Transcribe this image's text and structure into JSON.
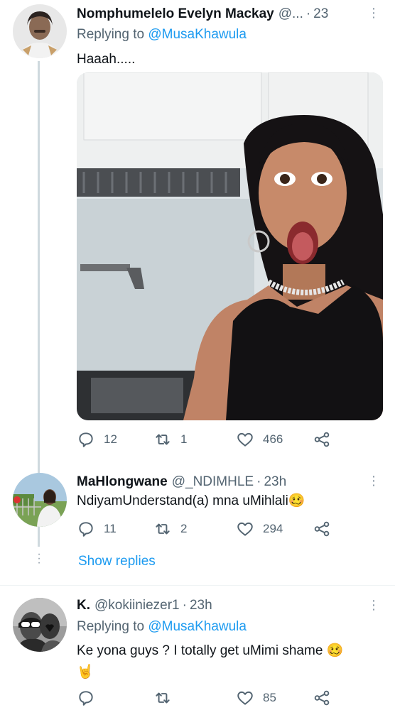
{
  "tweets": [
    {
      "name": "Nomphumelelo Evelyn Mackay",
      "handle": "@...",
      "time": "23h",
      "replying_label": "Replying to",
      "replying_to": "@MusaKhawula",
      "text": "Haaah.....",
      "replies": "12",
      "retweets": "1",
      "likes": "466"
    },
    {
      "name": "MaHlongwane",
      "handle": "@_NDIMHLE",
      "time": "23h",
      "text": "NdiyamUnderstand(a) mna uMihlali",
      "emoji": "🥴",
      "replies": "11",
      "retweets": "2",
      "likes": "294"
    },
    {
      "name": "K.",
      "handle": "@kokiiniezer1",
      "time": "23h",
      "replying_label": "Replying to",
      "replying_to": "@MusaKhawula",
      "text": "Ke yona guys ? I totally get uMimi shame",
      "emoji": "🥴",
      "emoji2": "🤘",
      "replies": "",
      "retweets": "",
      "likes": "85"
    }
  ],
  "show_replies": "Show replies",
  "separator": "·",
  "more_icon": "⋮"
}
